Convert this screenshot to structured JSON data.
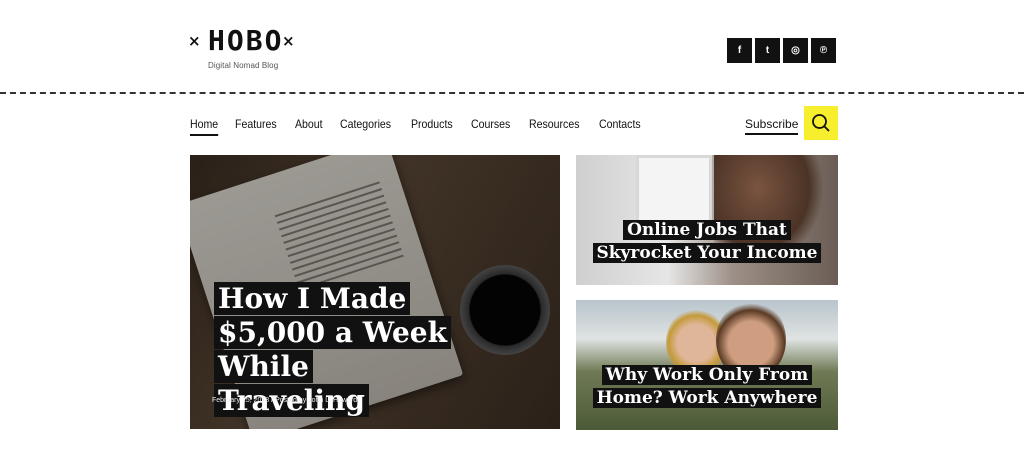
{
  "brand": {
    "name": "HOBO",
    "tagline": "Digital Nomad Blog",
    "mark_left": "×",
    "mark_right": "×"
  },
  "social": [
    {
      "icon": "facebook-icon",
      "glyph": "f"
    },
    {
      "icon": "twitter-icon",
      "glyph": "t"
    },
    {
      "icon": "instagram-icon",
      "glyph": "◎"
    },
    {
      "icon": "pinterest-icon",
      "glyph": "℗"
    }
  ],
  "nav": {
    "items": [
      "Home",
      "Features",
      "About",
      "Categories",
      "Products",
      "Courses",
      "Resources",
      "Contacts"
    ],
    "active": "Home",
    "subscribe": "Subscribe"
  },
  "colors": {
    "accent": "#f7ee2d",
    "dark": "#111111"
  },
  "featured": {
    "title": "How I Made $5,000 a Week While Traveling",
    "title_lines": [
      "How I Made",
      "$5,000 a Week While",
      "Traveling"
    ],
    "date": "February 15, 2018",
    "separator": "/",
    "author": "Posted by John L. Howard"
  },
  "side_posts": [
    {
      "title_lines": [
        "Online Jobs That",
        "Skyrocket Your Income"
      ]
    },
    {
      "title_lines": [
        "Why Work Only From",
        "Home? Work Anywhere"
      ]
    }
  ]
}
